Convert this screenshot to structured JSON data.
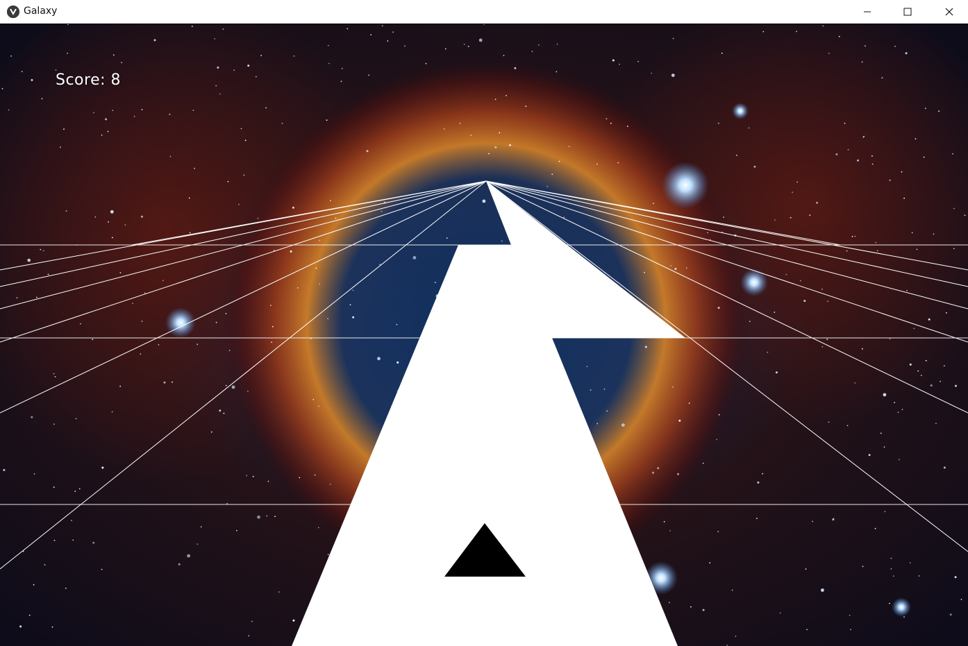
{
  "window": {
    "title": "Galaxy",
    "controls": [
      "minimize",
      "maximize",
      "close"
    ]
  },
  "hud": {
    "score_label": "Score: 8"
  },
  "colors": {
    "space_dark": "#0b0f24",
    "nebula_orange": "#e08a2a",
    "nebula_red": "#7a1e10",
    "nebula_blue": "#1a4a8c",
    "track_tiles": "#ffffff",
    "grid_lines": "#ffffff",
    "ship": "#000000"
  },
  "icons": {
    "app": "kivy-logo-icon",
    "minimize": "minimize-icon",
    "maximize": "maximize-icon",
    "close": "close-icon"
  }
}
